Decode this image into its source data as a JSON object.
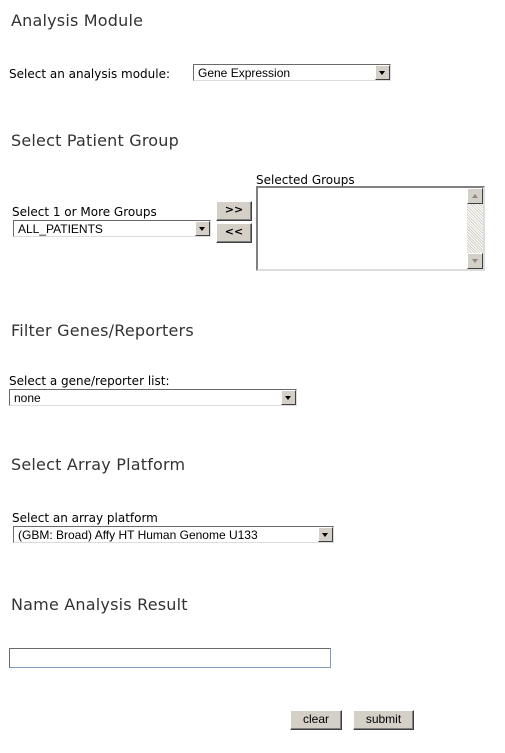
{
  "analysis": {
    "heading": "Analysis Module",
    "label": "Select an analysis module:",
    "selected": "Gene Expression"
  },
  "patient": {
    "heading": "Select Patient Group",
    "groups_label": "Select 1 or More Groups",
    "groups_selected": "ALL_PATIENTS",
    "add_label": ">>",
    "remove_label": "<<",
    "selected_groups_label": "Selected Groups",
    "selected_groups": []
  },
  "filter": {
    "heading": "Filter Genes/Reporters",
    "label": "Select a gene/reporter list:",
    "selected": "none"
  },
  "platform": {
    "heading": "Select Array Platform",
    "label": "Select an array platform",
    "selected": "(GBM: Broad) Affy HT Human Genome U133"
  },
  "result": {
    "heading": "Name Analysis Result",
    "value": ""
  },
  "actions": {
    "clear_label": "clear",
    "submit_label": "submit"
  }
}
